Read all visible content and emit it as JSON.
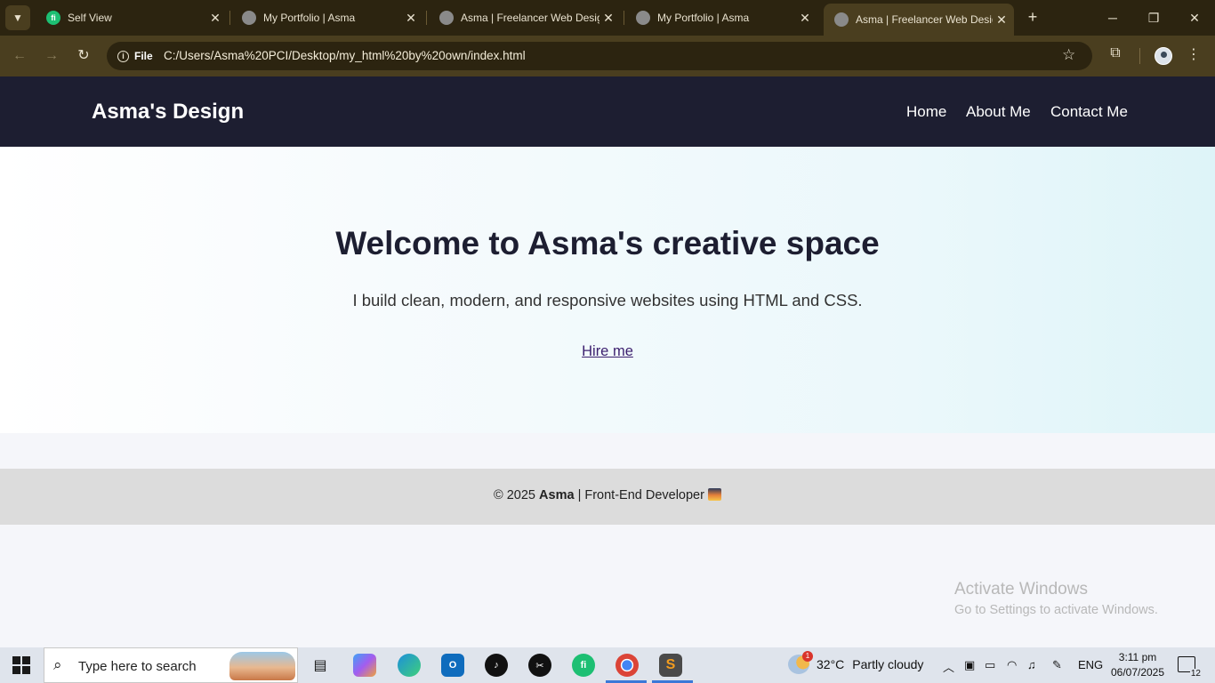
{
  "browser": {
    "tabs": [
      {
        "title": "Self View",
        "favicon": "fiverr-icon",
        "active": false
      },
      {
        "title": "My Portfolio | Asma",
        "favicon": "globe-icon",
        "active": false
      },
      {
        "title": "Asma | Freelancer Web Desig",
        "favicon": "globe-icon",
        "active": false
      },
      {
        "title": "My Portfolio | Asma",
        "favicon": "globe-icon",
        "active": false
      },
      {
        "title": "Asma | Freelancer Web Desig",
        "favicon": "globe-icon",
        "active": true
      }
    ],
    "new_tab_symbol": "+",
    "address": {
      "chip_label": "File",
      "url": "C:/Users/Asma%20PCI/Desktop/my_html%20by%20own/index.html"
    }
  },
  "site": {
    "logo": "Asma's Design",
    "nav": [
      "Home",
      "About Me",
      "Contact Me"
    ],
    "hero": {
      "title": "Welcome to Asma's creative space",
      "subtitle": "I build clean, modern, and responsive websites using HTML and CSS.",
      "cta": "Hire me"
    },
    "footer": {
      "prefix": "© 2025",
      "name": "Asma",
      "suffix": "| Front-End Developer"
    },
    "colors": {
      "header_bg": "#1d1e31",
      "footer_bg": "#dcdcdc",
      "link": "#3c1f6e"
    }
  },
  "watermark": {
    "line1": "Activate Windows",
    "line2": "Go to Settings to activate Windows."
  },
  "taskbar": {
    "search_placeholder": "Type here to search",
    "pinned": [
      "task-view-icon",
      "copilot-icon",
      "edge-icon",
      "outlook-icon",
      "tiktok-icon",
      "capcut-icon",
      "fiverr-icon",
      "chrome-icon",
      "sublime-text-icon"
    ],
    "weather": {
      "temperature": "32°C",
      "condition": "Partly cloudy",
      "alerts": "1"
    },
    "language": "ENG",
    "time": "3:11 pm",
    "date": "06/07/2025",
    "notifications": "12"
  }
}
